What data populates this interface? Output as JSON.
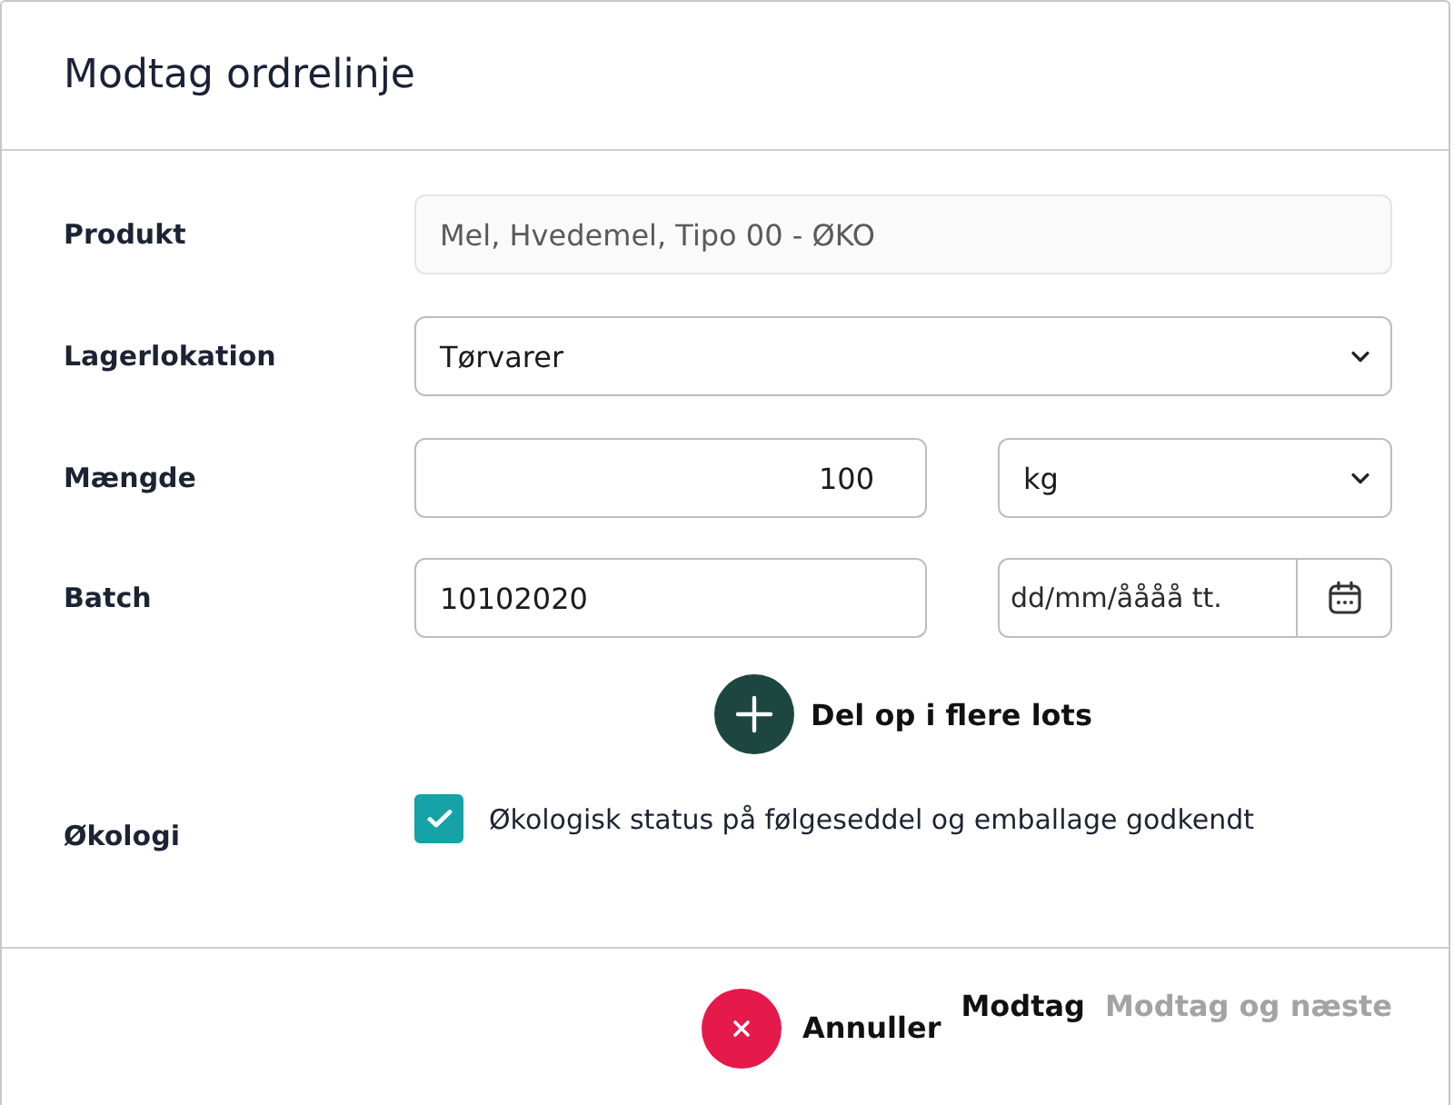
{
  "dialog": {
    "title": "Modtag ordrelinje"
  },
  "fields": [
    {
      "kind": "text",
      "label": "Produkt",
      "value": "Mel, Hvedemel, Tipo 00 - ØKO",
      "disabled": true
    },
    {
      "kind": "select",
      "label": "Lagerlokation",
      "value": "Tørvarer",
      "disabled": false
    },
    {
      "kind": "quantity",
      "label": "Mængde",
      "value": "100",
      "unit": "kg",
      "disabled": false
    },
    {
      "kind": "batch",
      "label": "Batch",
      "value": "10102020",
      "date_placeholder": "dd/mm/åååå tt.",
      "disabled": false
    }
  ],
  "split_button": {
    "label": "Del op i flere lots"
  },
  "organic": {
    "label": "Økologi",
    "checkbox_label": "Økologisk status på følgeseddel og emballage godkendt",
    "checked": true
  },
  "footer": {
    "buttons": [
      {
        "kind": "cancel",
        "label": "Annuller",
        "disabled": false
      },
      {
        "kind": "text",
        "label": "Modtag",
        "disabled": false
      },
      {
        "kind": "text",
        "label": "Modtag og næste",
        "disabled": true
      }
    ]
  }
}
